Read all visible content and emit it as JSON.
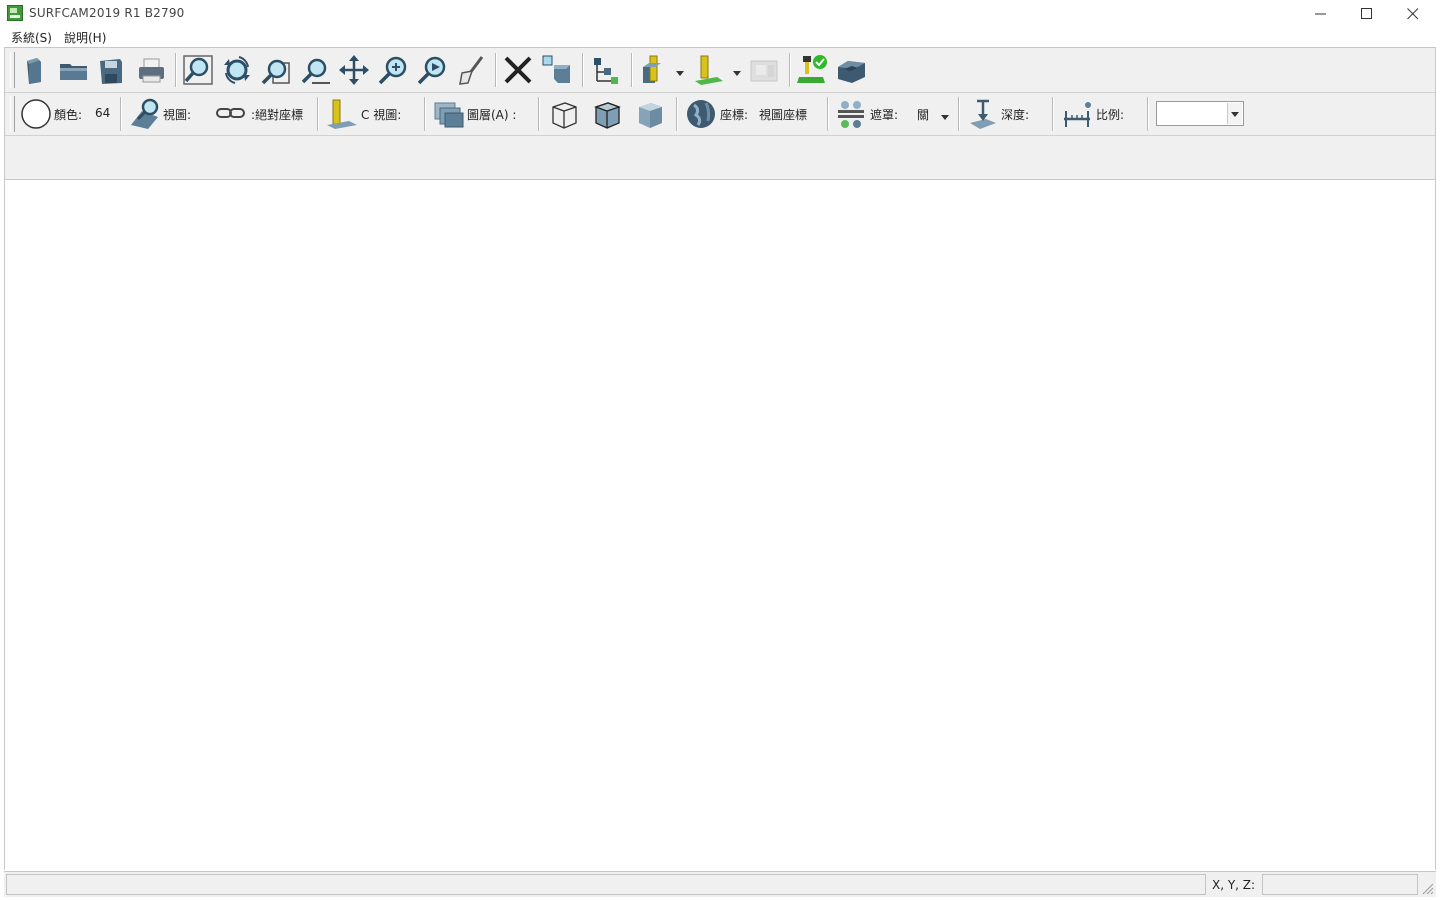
{
  "window": {
    "title": "SURFCAM2019 R1  B2790",
    "controls": [
      "minimize-icon",
      "maximize-icon",
      "close-icon"
    ]
  },
  "menu": [
    {
      "label": "系統(S)"
    },
    {
      "label": "說明(H)"
    }
  ],
  "toolbar1": {
    "buttons": [
      "new-file-icon",
      "open-folder-icon",
      "save-icon",
      "print-icon",
      "zoom-fit-icon",
      "zoom-rotate-icon",
      "zoom-window-icon",
      "zoom-out-icon",
      "pan-icon",
      "zoom-in-icon",
      "zoom-dynamic-icon",
      "brush-icon",
      "delete-icon",
      "move-object-icon",
      "tree-icon",
      "tool-dropdown-icon",
      "tool-plane-dropdown-icon",
      "machine-icon",
      "verify-icon",
      "simulate-icon"
    ]
  },
  "toolbar2": {
    "color_label": "顏色:",
    "color_value": "64",
    "view_label": "視圖:",
    "coord_mode": ":絕對座標",
    "cview_label": "C 視圖:",
    "layer_label": "圖層(A) :",
    "coord_label": "座標:",
    "coord_value": "視圖座標",
    "mask_label": "遮罩:",
    "mask_value": "關",
    "depth_label": "深度:",
    "scale_label": "比例:",
    "scale_value": ""
  },
  "status": {
    "coord_label": "X, Y, Z:",
    "coord_value": ""
  }
}
